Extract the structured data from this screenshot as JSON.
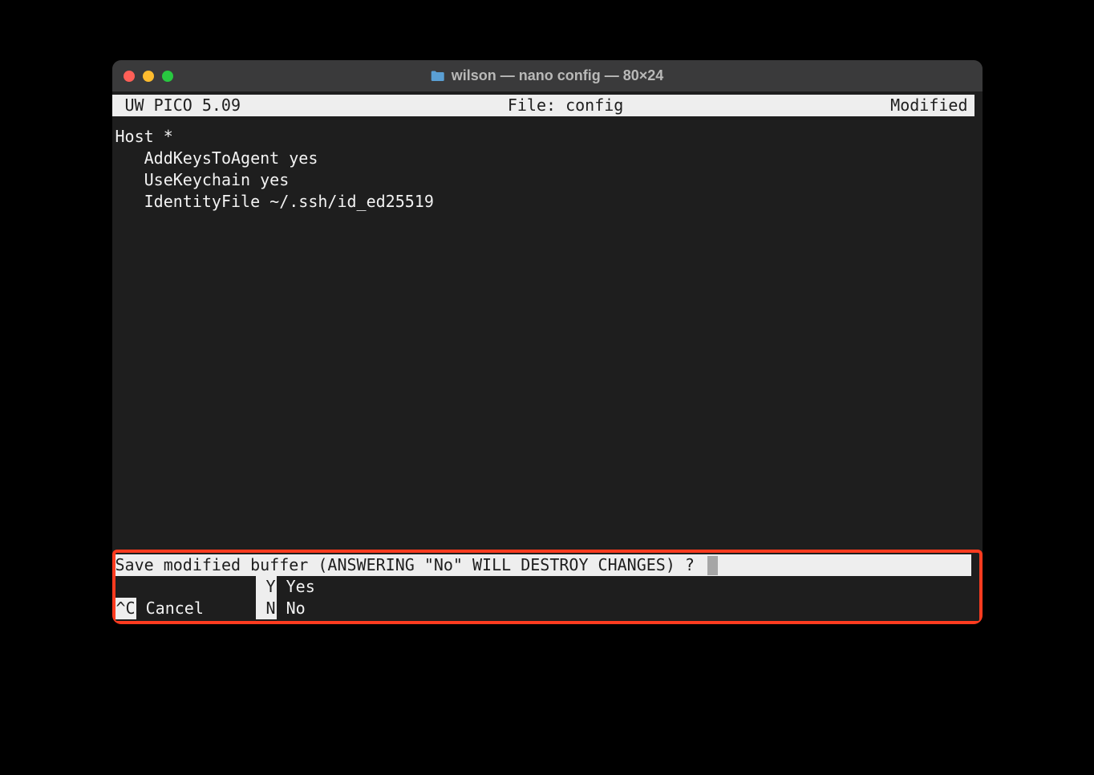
{
  "window": {
    "title": "wilson — nano config — 80×24"
  },
  "status": {
    "left": "UW PICO 5.09",
    "center": "File: config",
    "right": "Modified"
  },
  "content": {
    "lines": "Host *\n   AddKeysToAgent yes\n   UseKeychain yes\n   IdentityFile ~/.ssh/id_ed25519"
  },
  "prompt": {
    "text": "Save modified buffer (ANSWERING \"No\" WILL DESTROY CHANGES) ? "
  },
  "options": {
    "row1": {
      "col1": {
        "key": "",
        "label": ""
      },
      "col2": {
        "key": " Y",
        "label": " Yes"
      }
    },
    "row2": {
      "col1": {
        "key": "^C",
        "label": " Cancel"
      },
      "col2": {
        "key": " N",
        "label": " No"
      }
    }
  }
}
